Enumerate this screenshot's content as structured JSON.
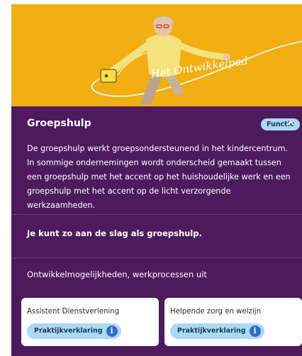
{
  "hero": {
    "label": "Het Ontwikkelpad"
  },
  "section": {
    "title": "Groepshulp",
    "badge": "Functie",
    "description": "De groepshulp werkt groepsondersteunend in het kindercentrum. In sommige ondernemingen wordt onderscheid gemaakt tussen een groepshulp met het accent op het huishoudelijke werk en een groepshulp met het accent op de licht verzorgende werkzaamheden.",
    "how_to_start": "Je kunt zo aan de slag als groepshulp.",
    "opportunities_heading": "Ontwikkelmogelijkheden, werkprocessen uit"
  },
  "tiles": [
    {
      "title": "Assistent Dienstverlening",
      "button": "Praktijkverklaring"
    },
    {
      "title": "Helpende zorg en welzijn",
      "button": "Praktijkverklaring"
    }
  ],
  "colors": {
    "hero": "#f1af12",
    "panel": "#4d1a5e",
    "pill": "#a9dbf3",
    "info": "#2f6ec9"
  }
}
